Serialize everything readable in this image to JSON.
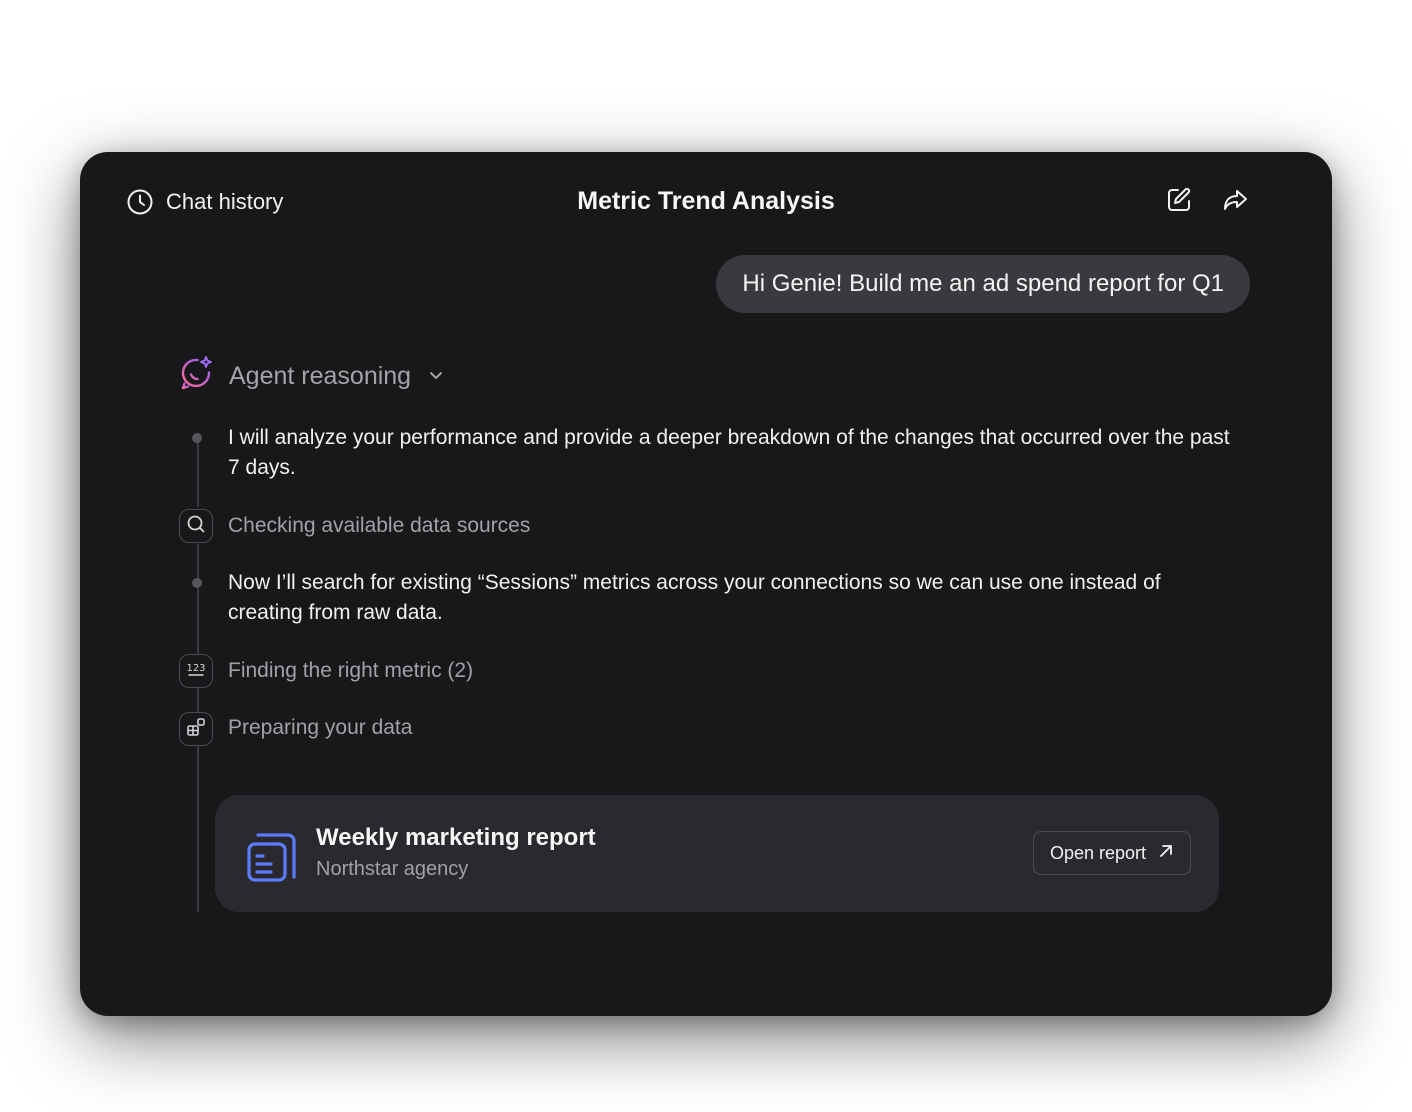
{
  "header": {
    "chat_history_label": "Chat history",
    "title": "Metric Trend Analysis"
  },
  "user_message": "Hi Genie! Build me an ad spend report for Q1",
  "reasoning": {
    "label": "Agent reasoning",
    "steps": [
      {
        "type": "text",
        "text": "I will analyze your performance and provide a deeper breakdown of the changes that occurred over the past 7 days."
      },
      {
        "type": "action",
        "icon": "search-icon",
        "text": "Checking available data sources"
      },
      {
        "type": "text",
        "text": "Now I’ll search for existing “Sessions” metrics across your connections so we can use one instead of creating from raw data."
      },
      {
        "type": "action",
        "icon": "numbers-icon",
        "text": "Finding the right metric (2)"
      },
      {
        "type": "action",
        "icon": "blocks-icon",
        "text": "Preparing your data"
      }
    ]
  },
  "report": {
    "title": "Weekly marketing report",
    "subtitle": "Northstar agency",
    "button_label": "Open report"
  },
  "colors": {
    "background": "#18181a",
    "bubble": "#3a3a3e",
    "card": "#2a2a2e",
    "report_icon": "#5b7cfa",
    "agent_gradient_start": "#ff6b9a",
    "agent_gradient_end": "#8b5cf6"
  }
}
